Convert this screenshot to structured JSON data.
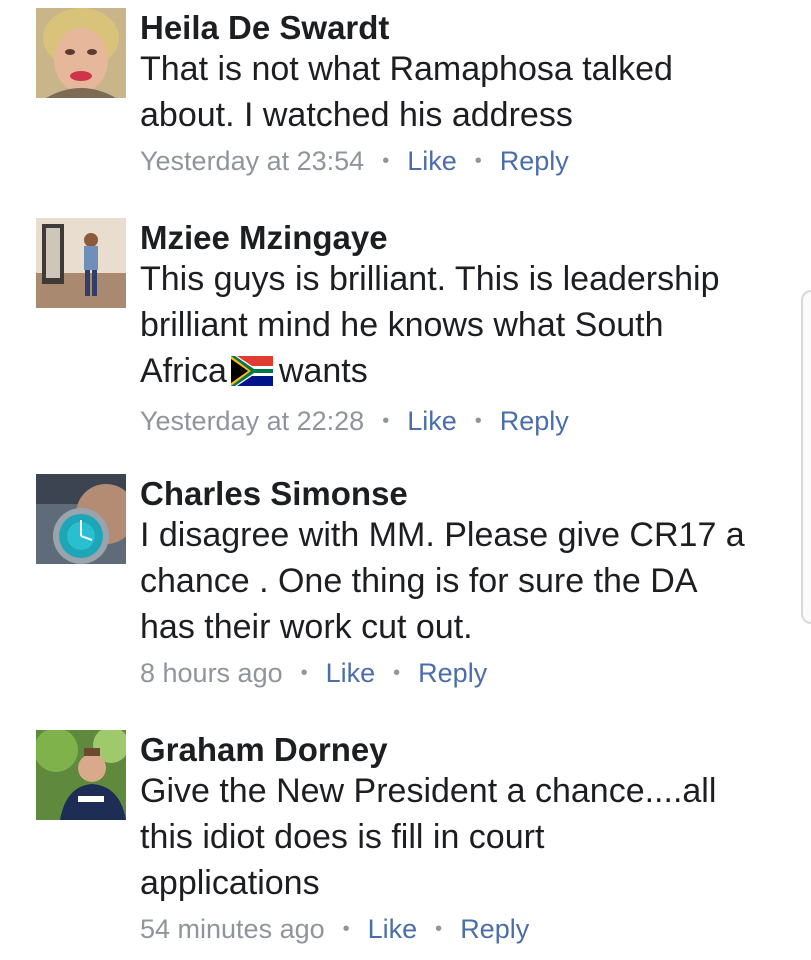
{
  "comments": [
    {
      "author": "Heila De Swardt",
      "text_lines": [
        "That is not what Ramaphosa talked",
        "about. I watched his address"
      ],
      "time": "Yesterday at 23:54",
      "like": "Like",
      "reply": "Reply"
    },
    {
      "author": "Mziee Mzingaye",
      "text_lines": [
        "This guys is brilliant. This is leadership",
        "brilliant mind he knows what South",
        "Africa",
        "wants"
      ],
      "time": "Yesterday at 22:28",
      "like": "Like",
      "reply": "Reply",
      "emoji": "south-africa-flag-icon"
    },
    {
      "author": "Charles Simonse",
      "text_lines": [
        "I disagree with MM. Please give CR17 a",
        "chance . One thing is for sure the DA",
        "has their work cut out."
      ],
      "time": "8 hours ago",
      "like": "Like",
      "reply": "Reply"
    },
    {
      "author": "Graham Dorney",
      "text_lines": [
        "Give the New President a chance....all",
        "this idiot does is fill in court",
        "applications"
      ],
      "time": "54 minutes ago",
      "like": "Like",
      "reply": "Reply"
    }
  ],
  "separator": "•",
  "colors": {
    "name": "#1c1e21",
    "text": "#1c1e21",
    "meta": "#90949c",
    "link": "#4b6eaa"
  }
}
